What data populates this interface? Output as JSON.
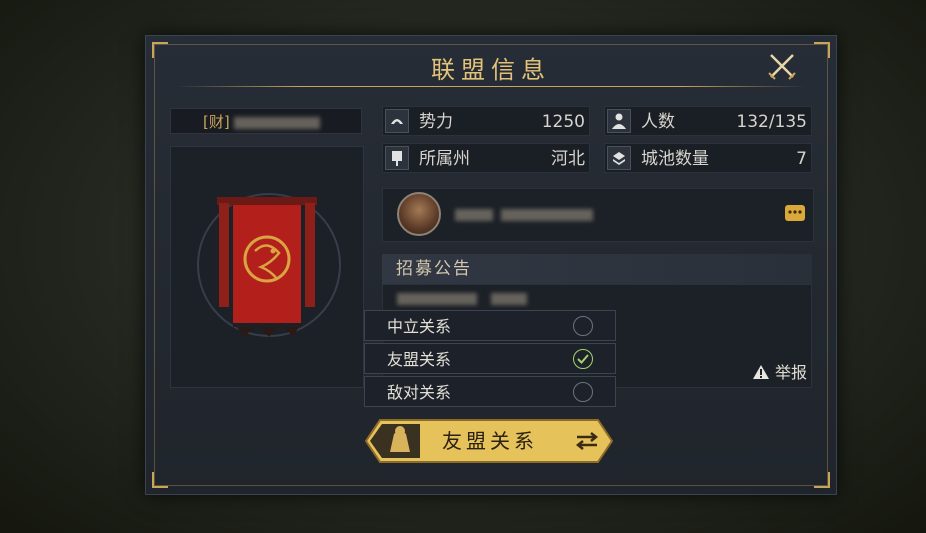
{
  "dialog": {
    "title": "联盟信息",
    "close_icon": "crossed-swords-icon"
  },
  "alliance": {
    "name_prefix": "[财]"
  },
  "stats": [
    {
      "icon": "power-icon",
      "label": "势力",
      "value": "1250"
    },
    {
      "icon": "people-icon",
      "label": "人数",
      "value": "132/135"
    },
    {
      "icon": "region-icon",
      "label": "所属州",
      "value": "河北"
    },
    {
      "icon": "city-icon",
      "label": "城池数量",
      "value": "7"
    }
  ],
  "notice": {
    "title": "招募公告"
  },
  "report": {
    "label": "举报",
    "icon": "warning-icon"
  },
  "relations": {
    "options": [
      {
        "label": "中立关系",
        "selected": false
      },
      {
        "label": "友盟关系",
        "selected": true
      },
      {
        "label": "敌对关系",
        "selected": false
      }
    ],
    "current_label": "友盟关系",
    "swap_icon": "swap-arrows-icon"
  },
  "colors": {
    "gold": "#c9a55c",
    "check": "#a5d36b",
    "button": "#e6c25a",
    "banner_red": "#b3201c"
  }
}
